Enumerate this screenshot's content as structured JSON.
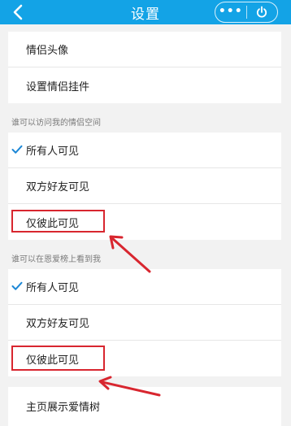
{
  "header": {
    "title": "设置",
    "more_icon": "more-dots-icon",
    "power_icon": "power-icon",
    "back_icon": "chevron-left-icon"
  },
  "colors": {
    "header_bg": "#13a3e6",
    "check": "#1c87d6",
    "annotation": "#d8262f"
  },
  "top_group": {
    "items": [
      {
        "label": "情侣头像"
      },
      {
        "label": "设置情侣挂件"
      }
    ]
  },
  "space_section": {
    "header": "谁可以访问我的情侣空间",
    "options": [
      {
        "label": "所有人可见",
        "selected": true
      },
      {
        "label": "双方好友可见",
        "selected": false
      },
      {
        "label": "仅彼此可见",
        "selected": false
      }
    ]
  },
  "ranking_section": {
    "header": "谁可以在恩爱榜上看到我",
    "options": [
      {
        "label": "所有人可见",
        "selected": true
      },
      {
        "label": "双方好友可见",
        "selected": false
      },
      {
        "label": "仅彼此可见",
        "selected": false
      }
    ]
  },
  "bottom_group": {
    "items": [
      {
        "label": "主页展示爱情树"
      }
    ]
  }
}
